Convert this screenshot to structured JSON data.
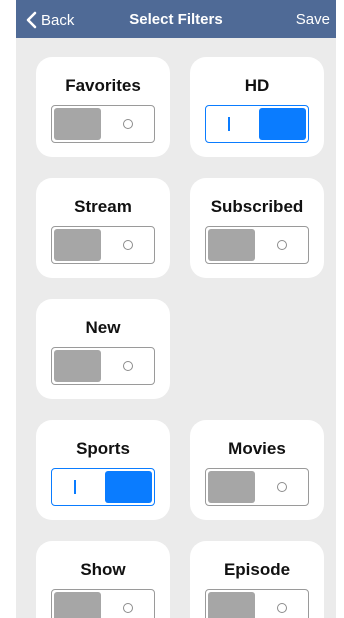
{
  "navbar": {
    "back_label": "Back",
    "title": "Select Filters",
    "save_label": "Save"
  },
  "filters": [
    {
      "label": "Favorites",
      "on": false
    },
    {
      "label": "HD",
      "on": true
    },
    {
      "label": "Stream",
      "on": false
    },
    {
      "label": "Subscribed",
      "on": false
    },
    {
      "label": "New",
      "on": false
    },
    {
      "label": "Sports",
      "on": true
    },
    {
      "label": "Movies",
      "on": false
    },
    {
      "label": "Show",
      "on": false
    },
    {
      "label": "Episode",
      "on": false
    }
  ],
  "icons": {
    "back": "chevron-left-icon"
  },
  "colors": {
    "navbar": "#4f6a96",
    "background": "#ebebeb",
    "toggle_on": "#0a7cff",
    "toggle_off": "#a6a6a6"
  }
}
